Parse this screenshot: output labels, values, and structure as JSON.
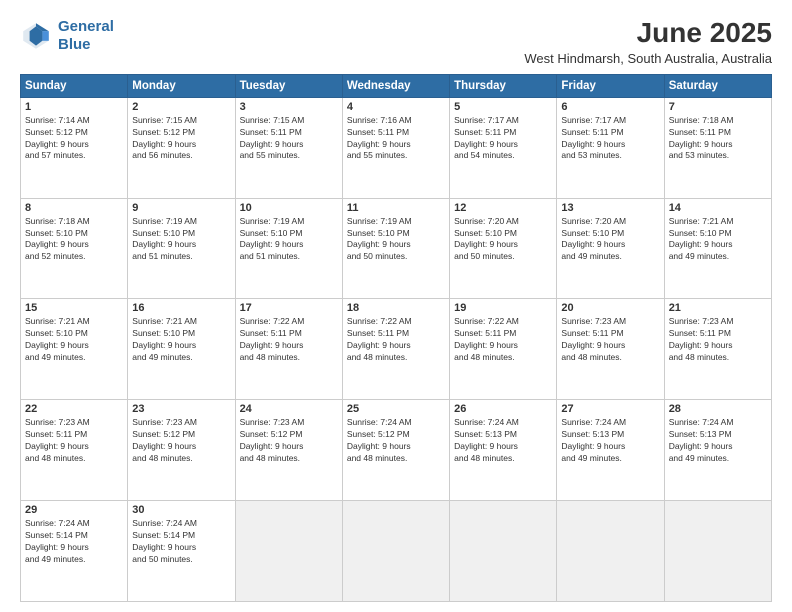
{
  "header": {
    "logo_line1": "General",
    "logo_line2": "Blue",
    "month": "June 2025",
    "location": "West Hindmarsh, South Australia, Australia"
  },
  "weekdays": [
    "Sunday",
    "Monday",
    "Tuesday",
    "Wednesday",
    "Thursday",
    "Friday",
    "Saturday"
  ],
  "weeks": [
    [
      {
        "day": "1",
        "info": "Sunrise: 7:14 AM\nSunset: 5:12 PM\nDaylight: 9 hours\nand 57 minutes."
      },
      {
        "day": "2",
        "info": "Sunrise: 7:15 AM\nSunset: 5:12 PM\nDaylight: 9 hours\nand 56 minutes."
      },
      {
        "day": "3",
        "info": "Sunrise: 7:15 AM\nSunset: 5:11 PM\nDaylight: 9 hours\nand 55 minutes."
      },
      {
        "day": "4",
        "info": "Sunrise: 7:16 AM\nSunset: 5:11 PM\nDaylight: 9 hours\nand 55 minutes."
      },
      {
        "day": "5",
        "info": "Sunrise: 7:17 AM\nSunset: 5:11 PM\nDaylight: 9 hours\nand 54 minutes."
      },
      {
        "day": "6",
        "info": "Sunrise: 7:17 AM\nSunset: 5:11 PM\nDaylight: 9 hours\nand 53 minutes."
      },
      {
        "day": "7",
        "info": "Sunrise: 7:18 AM\nSunset: 5:11 PM\nDaylight: 9 hours\nand 53 minutes."
      }
    ],
    [
      {
        "day": "8",
        "info": "Sunrise: 7:18 AM\nSunset: 5:10 PM\nDaylight: 9 hours\nand 52 minutes."
      },
      {
        "day": "9",
        "info": "Sunrise: 7:19 AM\nSunset: 5:10 PM\nDaylight: 9 hours\nand 51 minutes."
      },
      {
        "day": "10",
        "info": "Sunrise: 7:19 AM\nSunset: 5:10 PM\nDaylight: 9 hours\nand 51 minutes."
      },
      {
        "day": "11",
        "info": "Sunrise: 7:19 AM\nSunset: 5:10 PM\nDaylight: 9 hours\nand 50 minutes."
      },
      {
        "day": "12",
        "info": "Sunrise: 7:20 AM\nSunset: 5:10 PM\nDaylight: 9 hours\nand 50 minutes."
      },
      {
        "day": "13",
        "info": "Sunrise: 7:20 AM\nSunset: 5:10 PM\nDaylight: 9 hours\nand 49 minutes."
      },
      {
        "day": "14",
        "info": "Sunrise: 7:21 AM\nSunset: 5:10 PM\nDaylight: 9 hours\nand 49 minutes."
      }
    ],
    [
      {
        "day": "15",
        "info": "Sunrise: 7:21 AM\nSunset: 5:10 PM\nDaylight: 9 hours\nand 49 minutes."
      },
      {
        "day": "16",
        "info": "Sunrise: 7:21 AM\nSunset: 5:10 PM\nDaylight: 9 hours\nand 49 minutes."
      },
      {
        "day": "17",
        "info": "Sunrise: 7:22 AM\nSunset: 5:11 PM\nDaylight: 9 hours\nand 48 minutes."
      },
      {
        "day": "18",
        "info": "Sunrise: 7:22 AM\nSunset: 5:11 PM\nDaylight: 9 hours\nand 48 minutes."
      },
      {
        "day": "19",
        "info": "Sunrise: 7:22 AM\nSunset: 5:11 PM\nDaylight: 9 hours\nand 48 minutes."
      },
      {
        "day": "20",
        "info": "Sunrise: 7:23 AM\nSunset: 5:11 PM\nDaylight: 9 hours\nand 48 minutes."
      },
      {
        "day": "21",
        "info": "Sunrise: 7:23 AM\nSunset: 5:11 PM\nDaylight: 9 hours\nand 48 minutes."
      }
    ],
    [
      {
        "day": "22",
        "info": "Sunrise: 7:23 AM\nSunset: 5:11 PM\nDaylight: 9 hours\nand 48 minutes."
      },
      {
        "day": "23",
        "info": "Sunrise: 7:23 AM\nSunset: 5:12 PM\nDaylight: 9 hours\nand 48 minutes."
      },
      {
        "day": "24",
        "info": "Sunrise: 7:23 AM\nSunset: 5:12 PM\nDaylight: 9 hours\nand 48 minutes."
      },
      {
        "day": "25",
        "info": "Sunrise: 7:24 AM\nSunset: 5:12 PM\nDaylight: 9 hours\nand 48 minutes."
      },
      {
        "day": "26",
        "info": "Sunrise: 7:24 AM\nSunset: 5:13 PM\nDaylight: 9 hours\nand 48 minutes."
      },
      {
        "day": "27",
        "info": "Sunrise: 7:24 AM\nSunset: 5:13 PM\nDaylight: 9 hours\nand 49 minutes."
      },
      {
        "day": "28",
        "info": "Sunrise: 7:24 AM\nSunset: 5:13 PM\nDaylight: 9 hours\nand 49 minutes."
      }
    ],
    [
      {
        "day": "29",
        "info": "Sunrise: 7:24 AM\nSunset: 5:14 PM\nDaylight: 9 hours\nand 49 minutes."
      },
      {
        "day": "30",
        "info": "Sunrise: 7:24 AM\nSunset: 5:14 PM\nDaylight: 9 hours\nand 50 minutes."
      },
      {
        "day": "",
        "info": ""
      },
      {
        "day": "",
        "info": ""
      },
      {
        "day": "",
        "info": ""
      },
      {
        "day": "",
        "info": ""
      },
      {
        "day": "",
        "info": ""
      }
    ]
  ]
}
